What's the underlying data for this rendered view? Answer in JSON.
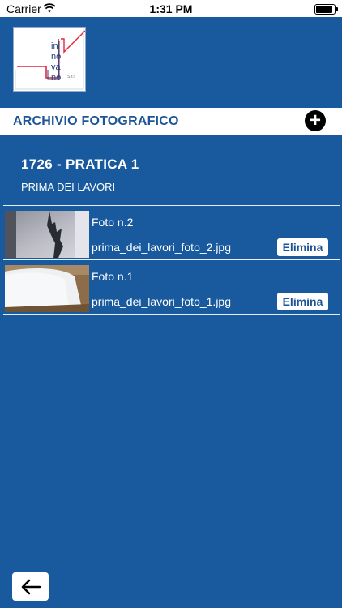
{
  "status_bar": {
    "carrier": "Carrier",
    "time": "1:31 PM"
  },
  "logo": {
    "lines": [
      "in",
      "no",
      "va",
      "no"
    ],
    "suffix": "S.r.l."
  },
  "section": {
    "title": "ARCHIVIO FOTOGRAFICO",
    "add_icon": "plus-circle-icon"
  },
  "practice": {
    "title": "1726 - PRATICA 1",
    "subtitle": "PRIMA DEI LAVORI"
  },
  "photos": [
    {
      "title": "Foto n.2",
      "filename": "prima_dei_lavori_foto_2.jpg",
      "delete_label": "Elimina"
    },
    {
      "title": "Foto n.1",
      "filename": "prima_dei_lavori_foto_1.jpg",
      "delete_label": "Elimina"
    }
  ],
  "back": {
    "icon": "arrow-left-icon"
  },
  "colors": {
    "background": "#185a9d",
    "accent_text": "#1d5596",
    "logo_red": "#e3263d"
  }
}
